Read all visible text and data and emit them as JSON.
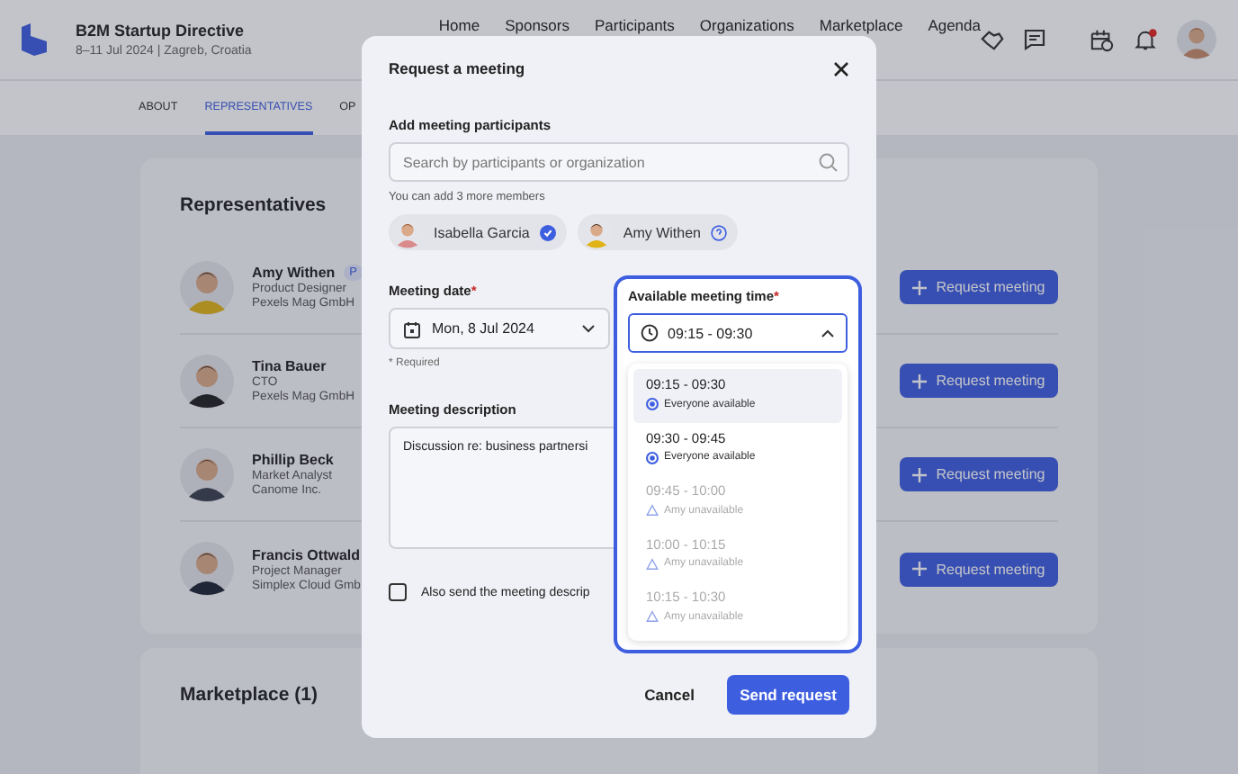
{
  "header": {
    "title": "B2M Startup Directive",
    "subtitle": "8–11 Jul 2024 | Zagreb, Croatia",
    "nav": [
      "Home",
      "Sponsors",
      "Participants",
      "Organizations",
      "Marketplace",
      "Agenda"
    ],
    "notification": true
  },
  "tabs": [
    {
      "label": "ABOUT",
      "selected": false
    },
    {
      "label": "REPRESENTATIVES",
      "selected": true
    },
    {
      "label": "OP",
      "selected": false
    }
  ],
  "representatives": {
    "title": "Representatives",
    "people": [
      {
        "name": "Amy Withen",
        "badge": "P",
        "role": "Product Designer",
        "company": "Pexels Mag GmbH",
        "button": "Request meeting"
      },
      {
        "name": "Tina Bauer",
        "role": "CTO",
        "company": "Pexels Mag GmbH",
        "button": "Request meeting"
      },
      {
        "name": "Phillip Beck",
        "role": "Market Analyst",
        "company": "Canome Inc.",
        "button": "Request meeting"
      },
      {
        "name": "Francis Ottwald",
        "role": "Project Manager",
        "company": "Simplex Cloud Gmb",
        "button": "Request meeting"
      }
    ]
  },
  "marketplace": {
    "title": "Marketplace (1)"
  },
  "modal": {
    "title": "Request a meeting",
    "participants_label": "Add meeting participants",
    "search": {
      "placeholder": "Search by participants or organization"
    },
    "helper": "You can add 3 more members",
    "chips": [
      {
        "name": "Isabella Garcia",
        "confirmed": true
      },
      {
        "name": "Amy Withen",
        "confirmed": false
      }
    ],
    "date": {
      "label": "Meeting date",
      "mark": "*",
      "value": "Mon, 8 Jul 2024",
      "note": "* Required"
    },
    "description": {
      "label": "Meeting description",
      "value": "Discussion re: business partnersi"
    },
    "checkbox": {
      "label": "Also send the meeting descrip",
      "checked": false
    },
    "time": {
      "label": "Available meeting time",
      "mark": "*",
      "value": "09:15 - 09:30",
      "expanded": true,
      "options": [
        {
          "time": "09:15 - 09:30",
          "note": "Everyone available",
          "available": true,
          "selected": true
        },
        {
          "time": "09:30 - 09:45",
          "note": "Everyone available",
          "available": true,
          "selected": false
        },
        {
          "time": "09:45 - 10:00",
          "note": "Amy unavailable",
          "available": false,
          "selected": false
        },
        {
          "time": "10:00 - 10:15",
          "note": "Amy unavailable",
          "available": false,
          "selected": false
        },
        {
          "time": "10:15 - 10:30",
          "note": "Amy unavailable",
          "available": false,
          "selected": false
        }
      ]
    },
    "buttons": {
      "cancel": "Cancel",
      "send": "Send request"
    }
  }
}
